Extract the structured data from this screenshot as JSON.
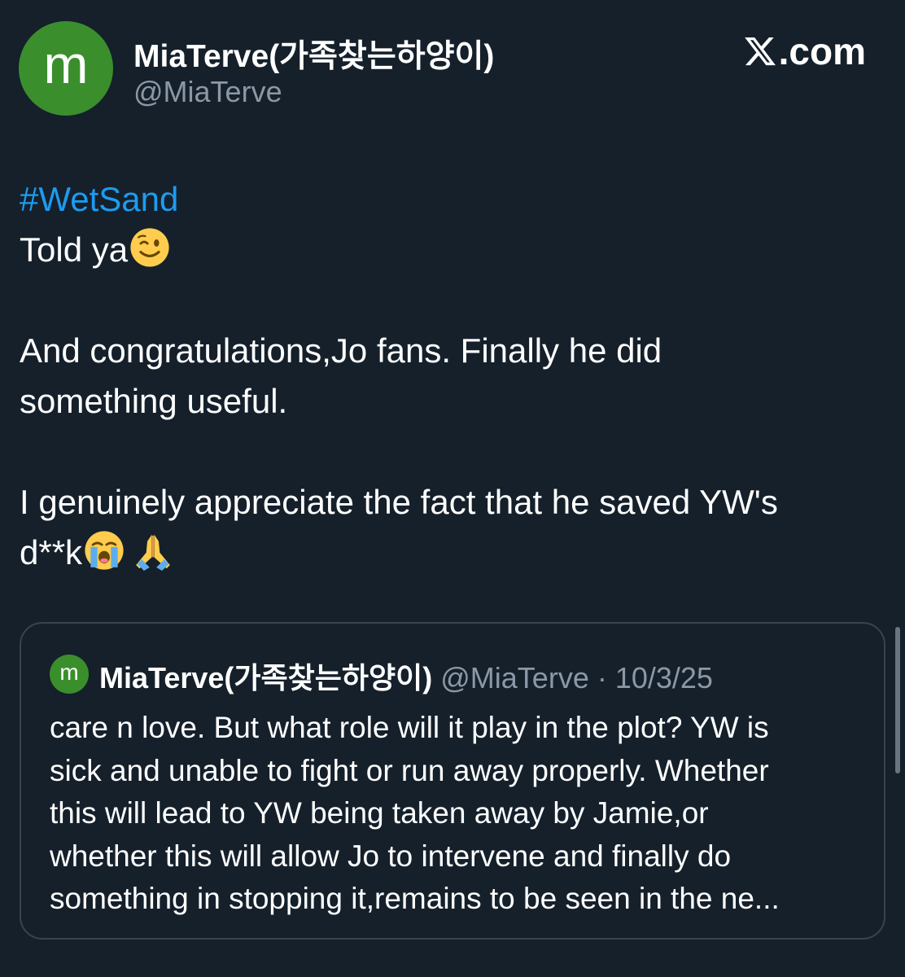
{
  "author": {
    "avatar_letter": "m",
    "avatar_color": "#3a8f2c",
    "display_name": "MiaTerve(가족찾는하양이)",
    "handle": "@MiaTerve"
  },
  "site_label": ".com",
  "icons": {
    "brand": "x-logo-icon",
    "emoji_1": "winking-face-emoji",
    "emoji_2": "loudly-crying-face-emoji",
    "emoji_3": "folded-hands-emoji"
  },
  "tweet": {
    "hashtag": "#WetSand",
    "line1": "Told ya",
    "para2_line1": "And congratulations,Jo fans. Finally he did",
    "para2_line2": "something useful.",
    "para3_line1": "I genuinely appreciate the fact that he saved YW's",
    "para3_line2": "d**k"
  },
  "quoted_tweet": {
    "avatar_letter": "m",
    "display_name": "MiaTerve(가족찾는하양이)",
    "meta": "@MiaTerve · 10/3/25",
    "lines": [
      "care n love. But what role will it play in the plot? YW is",
      "sick and unable to fight or run away properly. Whether",
      "this will lead to YW being taken away by Jamie,or",
      "whether this will allow Jo to intervene and finally do",
      "something in stopping it,remains to be seen in the ne..."
    ]
  },
  "colors": {
    "background": "#15202b",
    "link": "#1d9bf0",
    "secondary_text": "#8b98a5",
    "border": "#38444d"
  }
}
